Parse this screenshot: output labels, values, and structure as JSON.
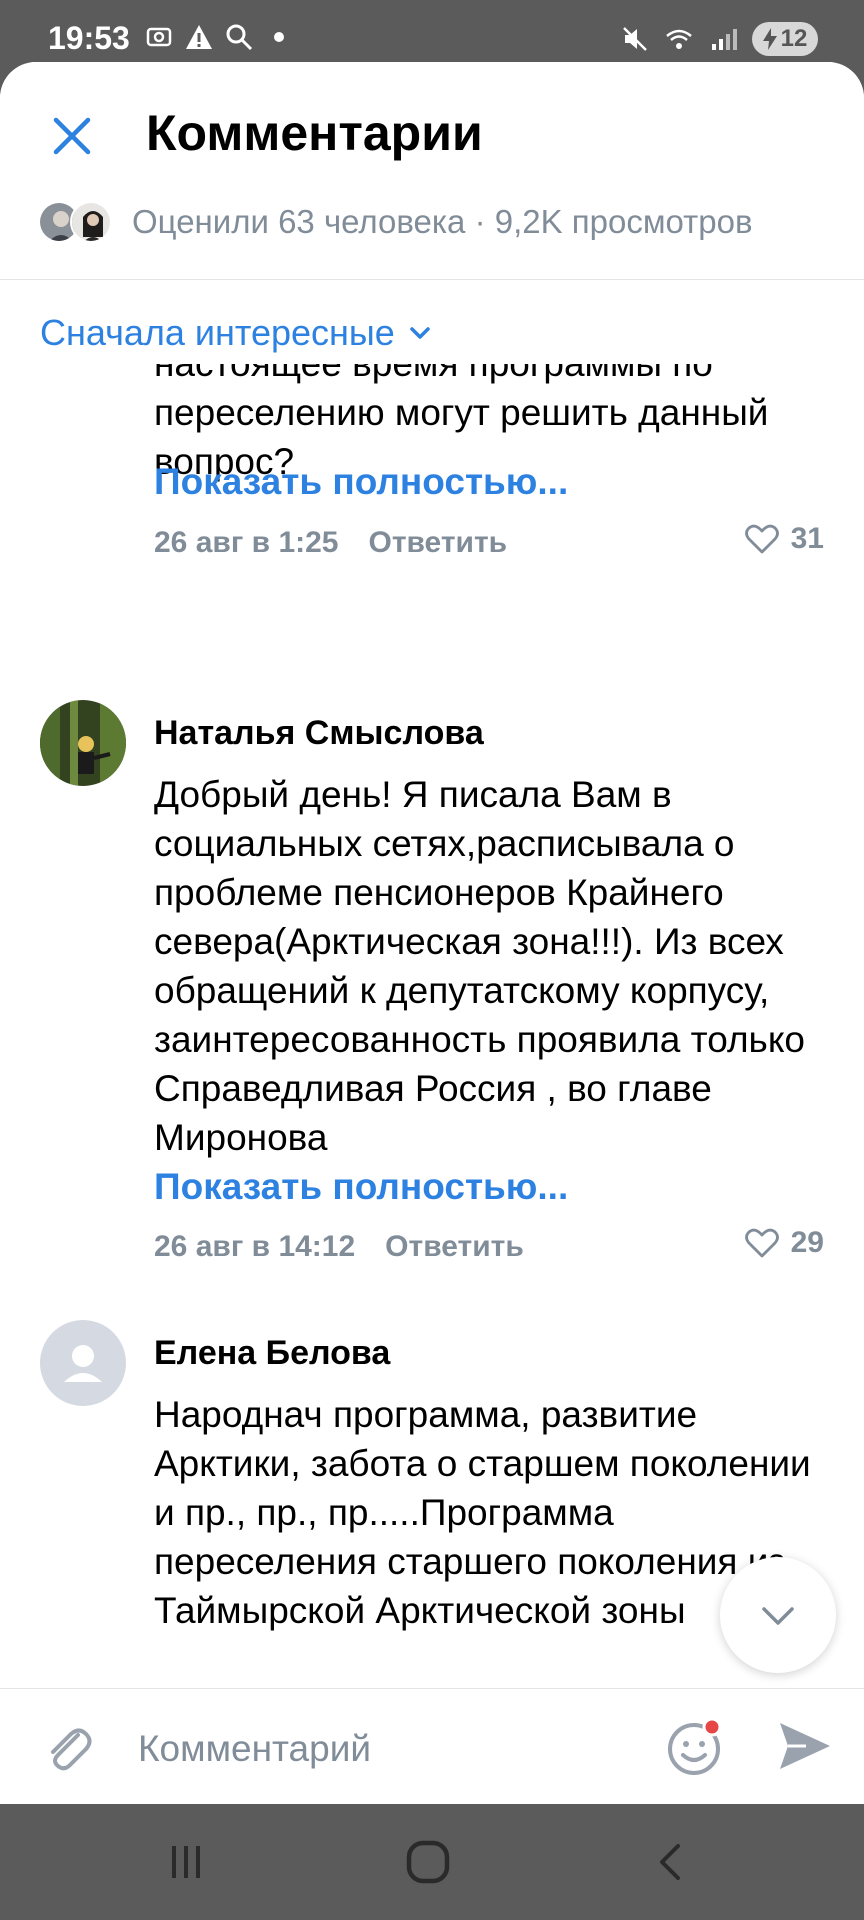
{
  "status_bar": {
    "time": "19:53",
    "battery": "12"
  },
  "header": {
    "title": "Комментарии",
    "liked_summary": "Оценили 63 человека · 9,2K просмотров"
  },
  "sort": {
    "label": "Сначала интересные"
  },
  "comments": [
    {
      "text": "Серьезно думаете, что работающие в настоящее время программы по переселению могут решить данный вопрос?",
      "show_more": "Показать полностью...",
      "date": "26 авг в 1:25",
      "reply": "Ответить",
      "likes": "31"
    },
    {
      "author": "Наталья Смыслова",
      "text": "Добрый день! Я писала Вам в социальных сетях,расписывала о проблеме пенсионеров Крайнего севера(Арктическая зона!!!). Из всех обращений к депутатскому корпусу, заинтересованность проявила только Справедливая Россия , во главе Миронова",
      "show_more": "Показать полностью...",
      "date": "26 авг в 14:12",
      "reply": "Ответить",
      "likes": "29"
    },
    {
      "author": "Елена Белова",
      "text": "Народнач программа, развитие Арктики, забота о старшем поколении и пр., пр., пр.....Программа переселения старшего поколения из Таймырской  Арктической зоны"
    }
  ],
  "composer": {
    "placeholder": "Комментарий"
  },
  "colors": {
    "accent": "#2d81e0",
    "secondary_text": "#818c99",
    "notification_dot": "#e64646"
  }
}
